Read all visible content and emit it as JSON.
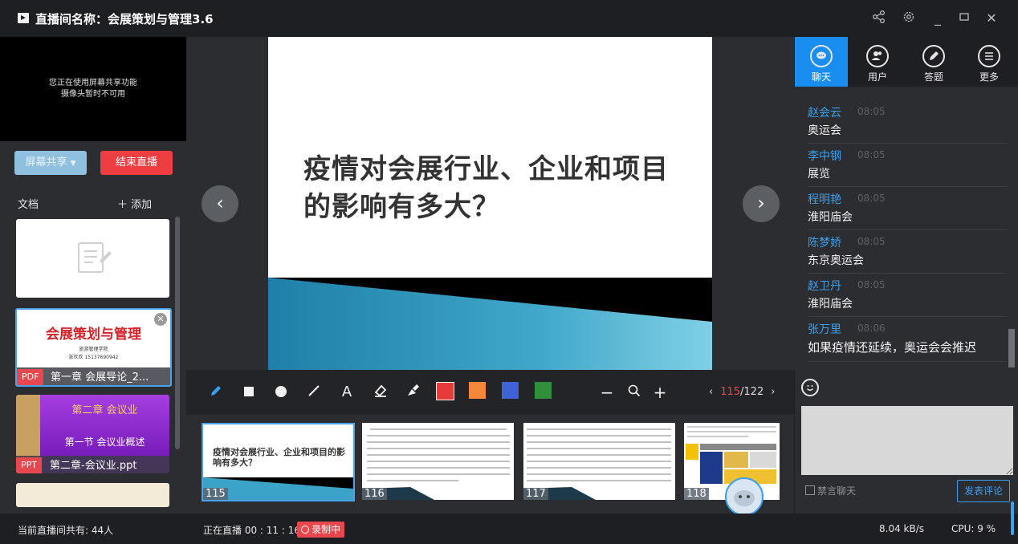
{
  "window": {
    "title": "直播间名称：会展策划与管理3.6",
    "controls": [
      "share-icon",
      "gear-icon",
      "minimize-icon",
      "maximize-icon",
      "close-icon"
    ]
  },
  "left": {
    "camera_notice_line1": "您正在使用屏幕共享功能",
    "camera_notice_line2": "摄像头暂时不可用",
    "share_button": "屏幕共享",
    "end_button": "结束直播",
    "docs_label": "文档",
    "add_label": "＋ 添加",
    "documents": [
      {
        "type": "",
        "name": "",
        "thumb_title": ""
      },
      {
        "type": "PDF",
        "name": "第一章 会展导论_2...",
        "thumb_title": "会展策划与管理",
        "thumb_sub1": "旅游管理学院",
        "thumb_sub2": "张欢欢  15137690942"
      },
      {
        "type": "PPT",
        "name": "第二章-会议业.ppt",
        "thumb_title": "第二章  会议业",
        "thumb_sub1": "第一节    会议业概述"
      },
      {
        "type": "",
        "name": ""
      }
    ]
  },
  "slide": {
    "title": "疲情对会展行业、企业和项目的影响有多大？",
    "title_text": "疫情对会展行业、企业和项目的影响有多大？"
  },
  "toolbar": {
    "tools": [
      "pen-icon",
      "rectangle-icon",
      "circle-icon",
      "line-icon",
      "text-icon",
      "eraser-icon",
      "clear-icon"
    ],
    "colors": [
      "#e83a3a",
      "#f5873a",
      "#3f63d6",
      "#2f8f3a"
    ],
    "zoom_out": "−",
    "zoom_in": "+",
    "page_current": "115",
    "page_total": "/122"
  },
  "thumbnails": [
    {
      "num": "115",
      "text": "疫情对会展行业、企业和项目的影响有多大？"
    },
    {
      "num": "116",
      "text": ""
    },
    {
      "num": "117",
      "text": ""
    },
    {
      "num": "118",
      "text": ""
    }
  ],
  "right": {
    "tabs": [
      {
        "label": "聊天",
        "icon": "chat-icon"
      },
      {
        "label": "用户",
        "icon": "users-icon"
      },
      {
        "label": "答题",
        "icon": "pen-circle-icon"
      },
      {
        "label": "更多",
        "icon": "more-icon"
      }
    ],
    "messages": [
      {
        "name": "赵会云",
        "time": "08:05",
        "text": "奥运会"
      },
      {
        "name": "李中钢",
        "time": "08:05",
        "text": "展览"
      },
      {
        "name": "程明艳",
        "time": "08:05",
        "text": "淮阳庙会"
      },
      {
        "name": "陈梦娇",
        "time": "08:05",
        "text": "东京奥运会"
      },
      {
        "name": "赵卫丹",
        "time": "08:05",
        "text": "淮阳庙会"
      },
      {
        "name": "张万里",
        "time": "08:06",
        "text": "如果疫情还延续，奥运会会推迟"
      }
    ],
    "mute_label": "禁言聊天",
    "send_label": "发表评论"
  },
  "status": {
    "viewers": "当前直播间共有: 44人",
    "live_time": "正在直播 00 : 11 : 16",
    "recording": "录制中",
    "net_speed": "8.04 kB/s",
    "cpu": "CPU:  9 %"
  }
}
